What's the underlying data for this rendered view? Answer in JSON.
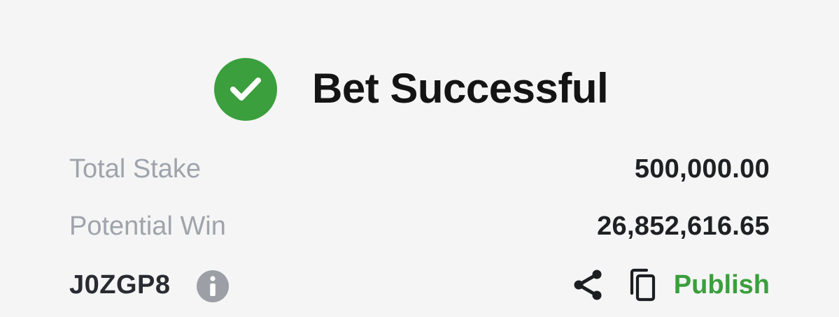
{
  "header": {
    "icon": "check-circle-icon",
    "title": "Bet Successful"
  },
  "summary": {
    "total_stake_label": "Total Stake",
    "total_stake_value": "500,000.00",
    "potential_win_label": "Potential Win",
    "potential_win_value": "26,852,616.65"
  },
  "booking": {
    "code": "J0ZGP8",
    "info_icon": "info-icon",
    "share_icon": "share-icon",
    "copy_icon": "copy-icon",
    "publish_label": "Publish"
  },
  "colors": {
    "success_green": "#3a9f3c",
    "label_gray": "#9fa3ab",
    "value_dark": "#1f2024",
    "background": "#f5f5f5"
  }
}
